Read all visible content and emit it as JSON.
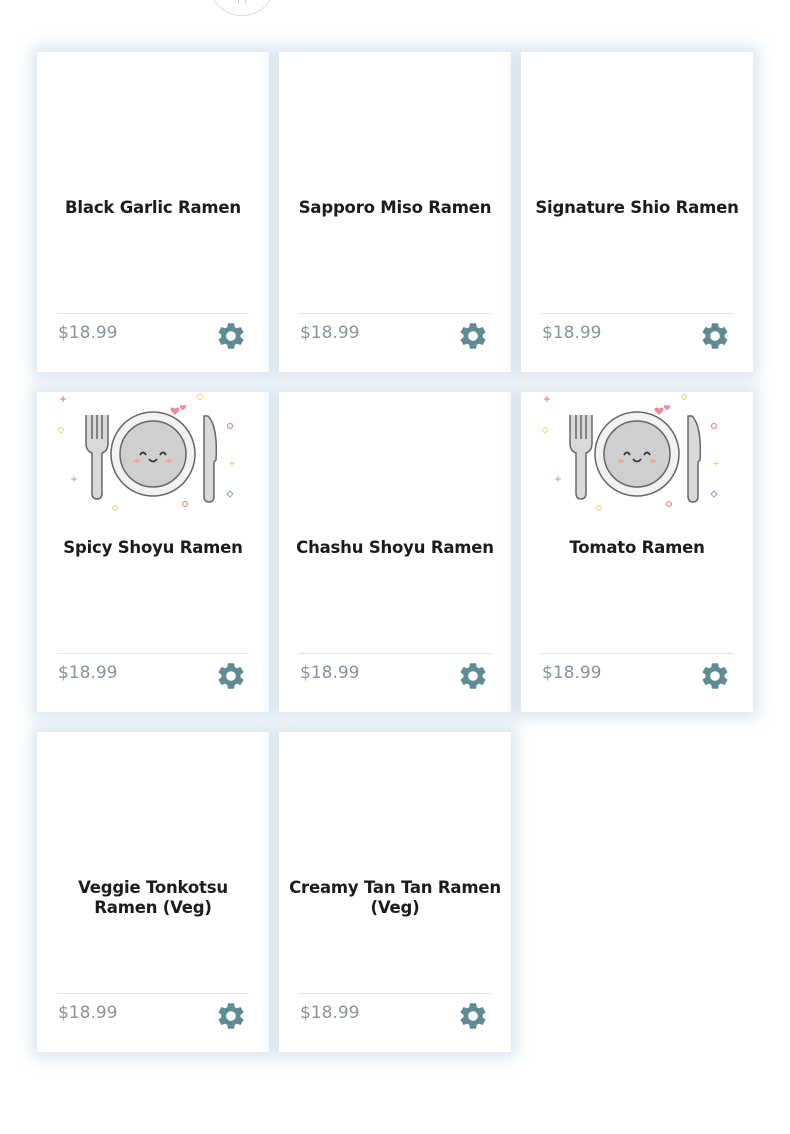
{
  "menu": {
    "items": [
      {
        "name": "Black Garlic Ramen",
        "price": "$18.99",
        "has_image": false
      },
      {
        "name": "Sapporo Miso Ramen",
        "price": "$18.99",
        "has_image": false
      },
      {
        "name": "Signature Shio Ramen",
        "price": "$18.99",
        "has_image": false
      },
      {
        "name": "Spicy Shoyu Ramen",
        "price": "$18.99",
        "has_image": true
      },
      {
        "name": "Chashu Shoyu Ramen",
        "price": "$18.99",
        "has_image": false
      },
      {
        "name": "Tomato Ramen",
        "price": "$18.99",
        "has_image": true
      },
      {
        "name": "Veggie Tonkotsu Ramen (Veg)",
        "price": "$18.99",
        "has_image": false
      },
      {
        "name": "Creamy Tan Tan Ramen (Veg)",
        "price": "$18.99",
        "has_image": false
      }
    ]
  },
  "icons": {
    "settings": "gear-icon",
    "placeholder": "plate-cutlery-icon"
  },
  "colors": {
    "gear": "#5e8b94",
    "price": "#8a929a",
    "title": "#1c1c1c",
    "card_shadow": "#b0cade"
  }
}
